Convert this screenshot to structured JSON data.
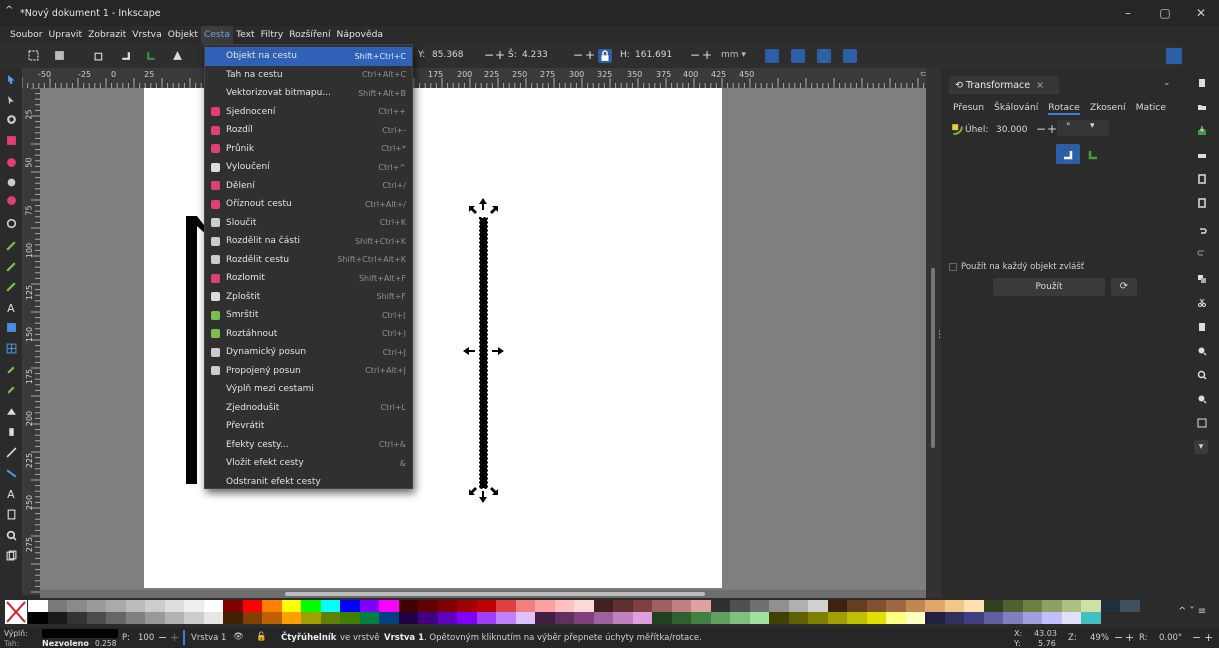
{
  "window": {
    "title": "*Nový dokument 1 - Inkscape",
    "controls": [
      "–",
      "▢",
      "✕"
    ]
  },
  "menubar": {
    "items": [
      "Soubor",
      "Upravit",
      "Zobrazit",
      "Vrstva",
      "Objekt",
      "Cesta",
      "Text",
      "Filtry",
      "Rozšíření",
      "Nápověda"
    ],
    "active": "Cesta"
  },
  "toolbar": {
    "y_label": "Y:",
    "y_value": "85.368",
    "w_label": "Š:",
    "w_value": "4.233",
    "h_label": "H:",
    "h_value": "161.691",
    "unit": "mm ▾",
    "minus": "−",
    "plus": "+"
  },
  "ruler_top": {
    "labels": [
      "-50",
      "-25",
      "0",
      "25",
      "175",
      "200",
      "225",
      "250",
      "275",
      "300",
      "325",
      "350",
      "375",
      "400",
      "425",
      "450"
    ]
  },
  "ruler_left": {
    "labels": [
      "25",
      "50",
      "75",
      "100",
      "125",
      "150",
      "175",
      "200",
      "225",
      "250",
      "275"
    ]
  },
  "dropdown": {
    "items": [
      {
        "label": "Objekt na cestu",
        "shortcut": "Shift+Ctrl+C",
        "icon": "none",
        "highlight": true
      },
      {
        "label": "Tah na cestu",
        "shortcut": "Ctrl+Alt+C",
        "icon": "none"
      },
      {
        "label": "Vektorizovat bitmapu...",
        "shortcut": "Shift+Alt+B",
        "icon": "none"
      },
      {
        "label": "Sjednocení",
        "shortcut": "Ctrl++",
        "icon": "union-icon"
      },
      {
        "label": "Rozdíl",
        "shortcut": "Ctrl+-",
        "icon": "difference-icon"
      },
      {
        "label": "Průnik",
        "shortcut": "Ctrl+*",
        "icon": "intersection-icon"
      },
      {
        "label": "Vyloučení",
        "shortcut": "Ctrl+^",
        "icon": "exclusion-icon"
      },
      {
        "label": "Dělení",
        "shortcut": "Ctrl+/",
        "icon": "division-icon"
      },
      {
        "label": "Oříznout cestu",
        "shortcut": "Ctrl+Alt+/",
        "icon": "cut-path-icon"
      },
      {
        "label": "Sloučit",
        "shortcut": "Ctrl+K",
        "icon": "combine-icon"
      },
      {
        "label": "Rozdělit na části",
        "shortcut": "Shift+Ctrl+K",
        "icon": "break-apart-icon"
      },
      {
        "label": "Rozdělit cestu",
        "shortcut": "Shift+Ctrl+Alt+K",
        "icon": "split-path-icon"
      },
      {
        "label": "Rozlomit",
        "shortcut": "Shift+Alt+F",
        "icon": "fracture-icon"
      },
      {
        "label": "Zploštit",
        "shortcut": "Shift+F",
        "icon": "flatten-icon"
      },
      {
        "label": "Smrštit",
        "shortcut": "Ctrl+(",
        "icon": "inset-icon"
      },
      {
        "label": "Roztáhnout",
        "shortcut": "Ctrl+)",
        "icon": "outset-icon"
      },
      {
        "label": "Dynamický posun",
        "shortcut": "Ctrl+J",
        "icon": "dynamic-offset-icon"
      },
      {
        "label": "Propojený posun",
        "shortcut": "Ctrl+Alt+J",
        "icon": "linked-offset-icon"
      },
      {
        "label": "Výplň mezi cestami",
        "shortcut": "",
        "icon": "none"
      },
      {
        "label": "Zjednodušit",
        "shortcut": "Ctrl+L",
        "icon": "none"
      },
      {
        "label": "Převrátit",
        "shortcut": "",
        "icon": "none"
      },
      {
        "label": "Efekty cesty...",
        "shortcut": "Ctrl+&",
        "icon": "none"
      },
      {
        "label": "Vložit efekt cesty",
        "shortcut": "&",
        "icon": "none"
      },
      {
        "label": "Odstranit efekt cesty",
        "shortcut": "",
        "icon": "none"
      }
    ]
  },
  "dock": {
    "tab_title": "Transformace",
    "tab_close": "×",
    "subtabs": [
      "Přesun",
      "Škálování",
      "Rotace",
      "Zkosení",
      "Matice"
    ],
    "selected_subtab": "Rotace",
    "angle_label": "Úhel:",
    "angle_value": "30.000",
    "minus": "−",
    "plus": "+",
    "unit_symbol": "°",
    "apply_each_label": "Použít na každý objekt zvlášť",
    "apply_button": "Použít"
  },
  "statusbar": {
    "fill_label": "Výplň:",
    "stroke_label": "Tah:",
    "stroke_value": "Nezvoleno",
    "stroke_width": "0.258",
    "opacity_label": "P:",
    "opacity_value": "100",
    "layer": "Vrstva 1",
    "message_bold": "Čtyřúhelník",
    "message_mid": "ve vrstvě",
    "message_layer": "Vrstva 1",
    "message_rest": ". Opětovným kliknutím na výběr přepnete úchyty měřítka/rotace.",
    "x_label": "X:",
    "x_value": "43.03",
    "y_label": "Y:",
    "y_value": "5.76",
    "zoom_label": "Z:",
    "zoom_value": "49%",
    "rot_label": "R:",
    "rot_value": "0.00°"
  },
  "colors": {
    "accent": "#2f62b7",
    "menu_bg": "#303030",
    "bg": "#2b2b2b"
  },
  "palette": {
    "row1": [
      "#ffffff",
      "#7a7a7a",
      "#8a8a8a",
      "#9a9a9a",
      "#aaaaaa",
      "#bbbbbb",
      "#cccccc",
      "#dddddd",
      "#eeeeee",
      "#ffffff",
      "#800000",
      "#ff0000",
      "#ff8000",
      "#ffff00",
      "#00ff00",
      "#00ffff",
      "#0000ff",
      "#8000ff",
      "#ff00ff",
      "#400000",
      "#600000",
      "#800000",
      "#a00000",
      "#c00000",
      "#e04040",
      "#f08080",
      "#ffa0a0",
      "#ffc0c0",
      "#ffd8d8",
      "#402020",
      "#603030",
      "#804040",
      "#a06060",
      "#c08080",
      "#e0a0a0",
      "#303030",
      "#505050",
      "#707070",
      "#909090",
      "#b0b0b0",
      "#d0d0d0",
      "#402010",
      "#604020",
      "#805030",
      "#a06840",
      "#c08850",
      "#e0a868",
      "#f0c888",
      "#ffe0b0",
      "#304020",
      "#506030",
      "#708040",
      "#90a060",
      "#b0c080",
      "#d0e0a0",
      "#203040",
      "#405060"
    ],
    "row2": [
      "#000000",
      "#1a1a1a",
      "#333333",
      "#4d4d4d",
      "#666666",
      "#808080",
      "#999999",
      "#b3b3b3",
      "#cccccc",
      "#e6e6e6",
      "#402000",
      "#804000",
      "#c06000",
      "#ffa000",
      "#a0a000",
      "#608000",
      "#408000",
      "#008040",
      "#004080",
      "#200040",
      "#400080",
      "#6000c0",
      "#8000ff",
      "#a040ff",
      "#c080ff",
      "#e0c0ff",
      "#402040",
      "#603060",
      "#804080",
      "#a060a0",
      "#c080c0",
      "#e0a0e0",
      "#204020",
      "#306030",
      "#408040",
      "#60a060",
      "#80c080",
      "#a0e0a0",
      "#404000",
      "#606000",
      "#808000",
      "#a0a000",
      "#c0c000",
      "#e0e000",
      "#ffff80",
      "#ffffc0",
      "#202040",
      "#303060",
      "#404080",
      "#6060a0",
      "#8080c0",
      "#a0a0e0",
      "#c0c0ff",
      "#e0e0ff",
      "#40c0c0"
    ]
  }
}
